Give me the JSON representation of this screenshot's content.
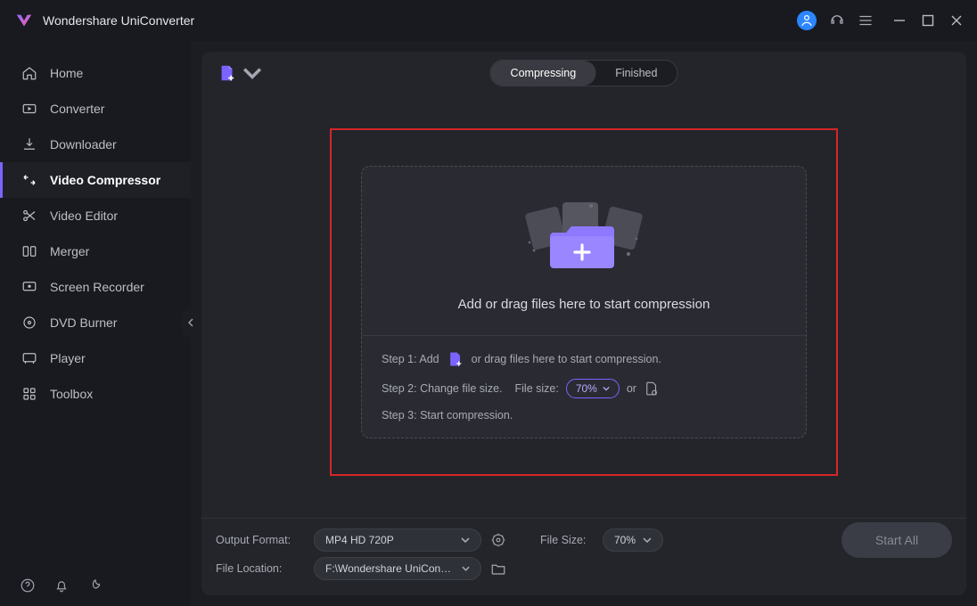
{
  "app_title": "Wondershare UniConverter",
  "sidebar": {
    "items": [
      {
        "label": "Home"
      },
      {
        "label": "Converter"
      },
      {
        "label": "Downloader"
      },
      {
        "label": "Video Compressor"
      },
      {
        "label": "Video Editor"
      },
      {
        "label": "Merger"
      },
      {
        "label": "Screen Recorder"
      },
      {
        "label": "DVD Burner"
      },
      {
        "label": "Player"
      },
      {
        "label": "Toolbox"
      }
    ]
  },
  "tabs": {
    "compressing": "Compressing",
    "finished": "Finished"
  },
  "drop": {
    "headline": "Add or drag files here to start compression",
    "step1_a": "Step 1: Add",
    "step1_b": "or drag files here to start compression.",
    "step2_a": "Step 2: Change file size.",
    "step2_b": "File size:",
    "step2_value": "70%",
    "step2_or": "or",
    "step3": "Step 3: Start compression."
  },
  "footer": {
    "output_label": "Output Format:",
    "output_value": "MP4 HD 720P",
    "filesize_label": "File Size:",
    "filesize_value": "70%",
    "location_label": "File Location:",
    "location_value": "F:\\Wondershare UniConverter",
    "start_label": "Start All"
  }
}
